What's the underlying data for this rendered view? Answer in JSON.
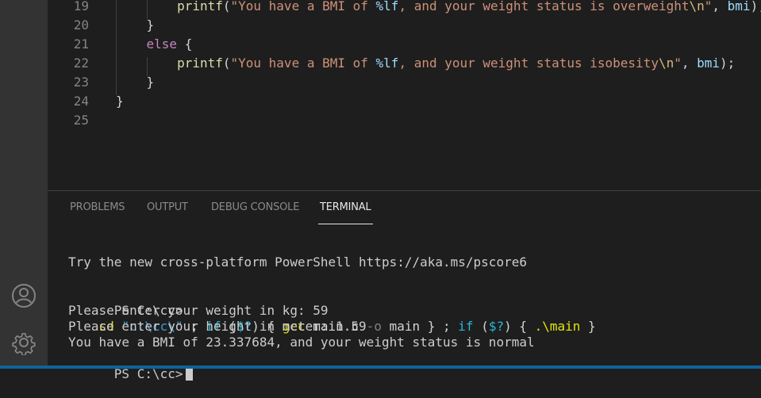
{
  "editor": {
    "lines": [
      {
        "num": "19",
        "indent": "        ",
        "tokens": [
          [
            "fn",
            "printf"
          ],
          [
            "plain",
            "("
          ],
          [
            "str",
            "\"You have a BMI of "
          ],
          [
            "fmt",
            "%lf"
          ],
          [
            "str",
            ", and your weight status is overweight"
          ],
          [
            "esc",
            "\\n"
          ],
          [
            "str",
            "\""
          ],
          [
            "plain",
            ", "
          ],
          [
            "var",
            "bmi"
          ],
          [
            "plain",
            ");"
          ]
        ]
      },
      {
        "num": "20",
        "indent": "    ",
        "tokens": [
          [
            "plain",
            "}"
          ]
        ]
      },
      {
        "num": "21",
        "indent": "    ",
        "tokens": [
          [
            "kw",
            "else"
          ],
          [
            "plain",
            " {"
          ]
        ]
      },
      {
        "num": "22",
        "indent": "        ",
        "tokens": [
          [
            "fn",
            "printf"
          ],
          [
            "plain",
            "("
          ],
          [
            "str",
            "\"You have a BMI of "
          ],
          [
            "fmt",
            "%lf"
          ],
          [
            "str",
            ", and your weight status isobesity"
          ],
          [
            "esc",
            "\\n"
          ],
          [
            "str",
            "\""
          ],
          [
            "plain",
            ", "
          ],
          [
            "var",
            "bmi"
          ],
          [
            "plain",
            ");"
          ]
        ]
      },
      {
        "num": "23",
        "indent": "    ",
        "tokens": [
          [
            "plain",
            "}"
          ]
        ]
      },
      {
        "num": "24",
        "indent": "",
        "tokens": [
          [
            "plain",
            "}"
          ]
        ]
      },
      {
        "num": "25",
        "indent": "",
        "tokens": []
      }
    ]
  },
  "panel": {
    "tabs": [
      {
        "label": "PROBLEMS",
        "active": false
      },
      {
        "label": "OUTPUT",
        "active": false
      },
      {
        "label": "DEBUG CONSOLE",
        "active": false
      },
      {
        "label": "TERMINAL",
        "active": true
      }
    ]
  },
  "terminal": {
    "banner": "Try the new cross-platform PowerShell https://aka.ms/pscore6",
    "command_prompt": "PS C:\\cc> ",
    "command_tokens": [
      [
        "t-yellow",
        "cd"
      ],
      [
        "plain",
        " "
      ],
      [
        "t-cyan",
        "\"c:\\cc\\\""
      ],
      [
        "plain",
        " ; "
      ],
      [
        "t-green",
        "if"
      ],
      [
        "plain",
        " ("
      ],
      [
        "t-green",
        "$?"
      ],
      [
        "plain",
        ") { "
      ],
      [
        "t-yellow",
        "gcc"
      ],
      [
        "plain",
        " main.c "
      ],
      [
        "t-gray",
        "-o"
      ],
      [
        "plain",
        " main } ; "
      ],
      [
        "t-green",
        "if"
      ],
      [
        "plain",
        " ("
      ],
      [
        "t-green",
        "$?"
      ],
      [
        "plain",
        ") { "
      ],
      [
        "t-yellow",
        ".\\main"
      ],
      [
        "plain",
        " }"
      ]
    ],
    "output_lines": [
      "Please enter your weight in kg: 59",
      "Please enter your height in meter: 1.59",
      "You have a BMI of 23.337684, and your weight status is normal"
    ],
    "final_prompt": "PS C:\\cc>"
  },
  "activity_bar": {
    "icons": [
      "account-icon",
      "gear-icon"
    ]
  },
  "colors": {
    "editor_bg": "#1e1e1e",
    "activity_bg": "#333333",
    "status_bar": "#0e639c"
  }
}
